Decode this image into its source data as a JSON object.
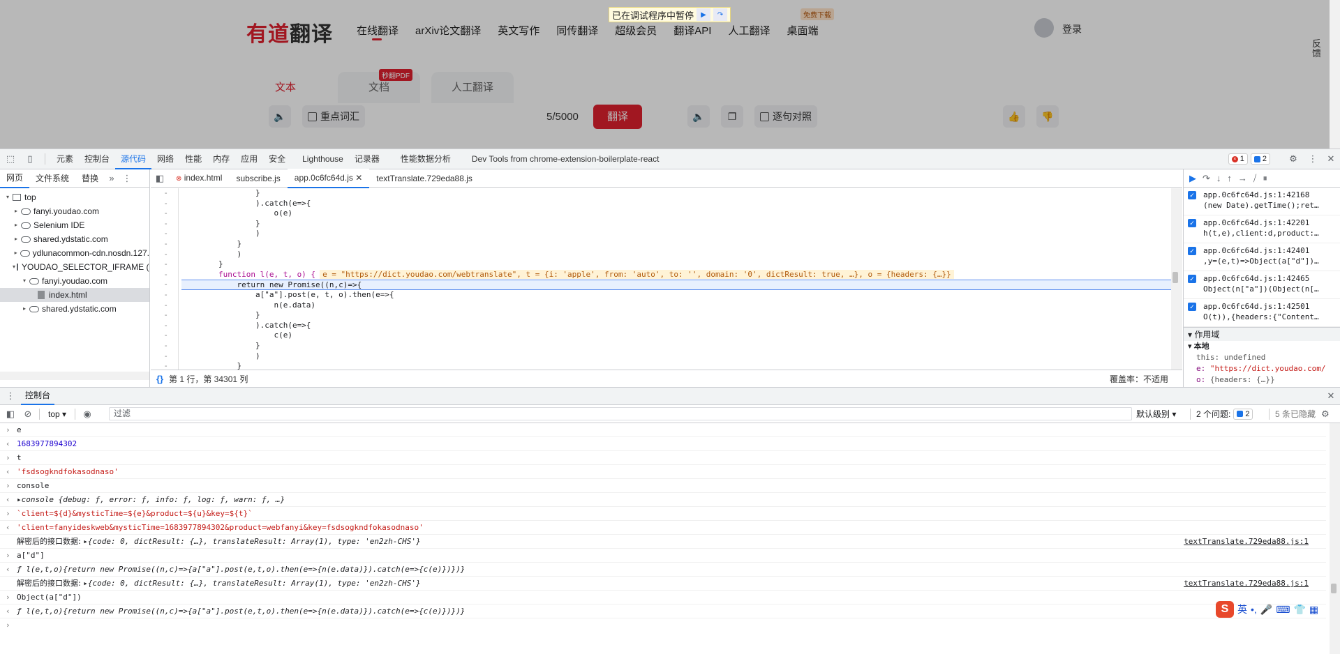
{
  "webpage": {
    "logo_red": "有道",
    "logo_dark": "翻译",
    "nav": [
      "在线翻译",
      "arXiv论文翻译",
      "英文写作",
      "同传翻译",
      "超级会员",
      "翻译API",
      "人工翻译",
      "桌面端"
    ],
    "download_badge": "免费下载",
    "paused_text": "已在调试程序中暂停",
    "login": "登录",
    "feedback": "反馈",
    "tabs": [
      "文本",
      "文档",
      "人工翻译"
    ],
    "pdf_badge": "秒翻PDF",
    "key_vocab": "重点词汇",
    "char_count": "5/5000",
    "translate_button": "翻译",
    "sentence_compare": "逐句对照"
  },
  "devtools": {
    "main_tabs": [
      "元素",
      "控制台",
      "源代码",
      "网络",
      "性能",
      "内存",
      "应用",
      "安全",
      "Lighthouse",
      "记录器",
      "性能数据分析",
      "Dev Tools from chrome-extension-boilerplate-react"
    ],
    "active_main_tab": "源代码",
    "error_count": "1",
    "message_count": "2",
    "navigator_tabs": [
      "网页",
      "文件系统",
      "替换"
    ],
    "tree": [
      {
        "label": "top",
        "depth": 0,
        "icon": "frame",
        "open": true
      },
      {
        "label": "fanyi.youdao.com",
        "depth": 1,
        "icon": "cloud"
      },
      {
        "label": "Selenium IDE",
        "depth": 1,
        "icon": "cloud"
      },
      {
        "label": "shared.ydstatic.com",
        "depth": 1,
        "icon": "cloud"
      },
      {
        "label": "ydlunacommon-cdn.nosdn.127.",
        "depth": 1,
        "icon": "cloud"
      },
      {
        "label": "YOUDAO_SELECTOR_IFRAME (in",
        "depth": 1,
        "icon": "frame",
        "open": true
      },
      {
        "label": "fanyi.youdao.com",
        "depth": 2,
        "icon": "cloud",
        "open": true
      },
      {
        "label": "index.html",
        "depth": 3,
        "icon": "file",
        "selected": true
      },
      {
        "label": "shared.ydstatic.com",
        "depth": 2,
        "icon": "cloud"
      }
    ],
    "editor_tabs": [
      "index.html",
      "subscribe.js",
      "app.0c6fc64d.js",
      "textTranslate.729eda88.js"
    ],
    "active_editor_tab": "app.0c6fc64d.js",
    "code_lines": [
      "                }",
      "                ).catch(e=>{",
      "                    o(e)",
      "                }",
      "                )",
      "            }",
      "            )",
      "        }",
      "        function l(e, t, o) {",
      "            return new Promise((n,c)=>{",
      "                a[\"a\"].post(e, t, o).then(e=>{",
      "                    n(e.data)",
      "                }",
      "                ).catch(e=>{",
      "                    c(e)",
      "                }",
      "                )",
      "            }",
      "            )"
    ],
    "inline_values": "e = \"https://dict.youdao.com/webtranslate\", t = {i: 'apple', from: 'auto', to: '', domain: '0', dictResult: true, …}, o = {headers: {…}}",
    "cursor_position": "第 1 行，第 34301 列",
    "coverage": "覆盖率：不适用",
    "breakpoints": [
      {
        "loc": "app.0c6fc64d.js:1:42168",
        "src": "(new Date).getTime();ret…"
      },
      {
        "loc": "app.0c6fc64d.js:1:42201",
        "src": "h(t,e),client:d,product:…"
      },
      {
        "loc": "app.0c6fc64d.js:1:42401",
        "src": ",y=(e,t)=>Object(a[\"d\"])…"
      },
      {
        "loc": "app.0c6fc64d.js:1:42465",
        "src": "Object(n[\"a\"])(Object(n[…"
      },
      {
        "loc": "app.0c6fc64d.js:1:42501",
        "src": "O(t)),{headers:{\"Content…"
      }
    ],
    "scope_header": "作用域",
    "scope_local": "本地",
    "scope_rows": [
      {
        "k": "this:",
        "v": "undefined"
      },
      {
        "k": "e:",
        "v": "\"https://dict.youdao.com/"
      },
      {
        "k": "o:",
        "v": "{headers: {…}}"
      }
    ],
    "drawer_tab": "控制台",
    "console_context": "top",
    "filter_placeholder": "过滤",
    "log_level": "默认级别",
    "issues_label": "2 个问题:",
    "issues_count": "2",
    "hidden_count": "5 条已隐藏",
    "console_lines": [
      {
        "kind": "in",
        "text": "e"
      },
      {
        "kind": "out",
        "cls": "c-num",
        "text": "1683977894302"
      },
      {
        "kind": "in",
        "text": "t"
      },
      {
        "kind": "out",
        "cls": "c-str",
        "text": "'fsdsogkndfokasodnaso'"
      },
      {
        "kind": "in",
        "text": "console"
      },
      {
        "kind": "out",
        "cls": "c-obj",
        "text": "▸console {debug: ƒ, error: ƒ, info: ƒ, log: ƒ, warn: ƒ, …}"
      },
      {
        "kind": "in",
        "cls": "c-str",
        "text": "`client=${d}&mysticTime=${e}&product=${u}&key=${t}`"
      },
      {
        "kind": "out",
        "cls": "c-str",
        "text": "'client=fanyideskweb&mysticTime=1683977894302&product=webfanyi&key=fsdsogkndfokasodnaso'"
      },
      {
        "kind": "log",
        "label": "解密后的接口数据:",
        "text": "▸{code: 0, dictResult: {…}, translateResult: Array(1), type: 'en2zh-CHS'}",
        "link": "textTranslate.729eda88.js:1"
      },
      {
        "kind": "in",
        "text": "a[\"d\"]"
      },
      {
        "kind": "out",
        "cls": "c-it",
        "text": "ƒ l(e,t,o){return new Promise((n,c)=>{a[\"a\"].post(e,t,o).then(e=>{n(e.data)}).catch(e=>{c(e)})})}"
      },
      {
        "kind": "log",
        "label": "解密后的接口数据:",
        "text": "▸{code: 0, dictResult: {…}, translateResult: Array(1), type: 'en2zh-CHS'}",
        "link": "textTranslate.729eda88.js:1"
      },
      {
        "kind": "in",
        "text": "Object(a[\"d\"])"
      },
      {
        "kind": "out",
        "cls": "c-it",
        "text": "ƒ l(e,t,o){return new Promise((n,c)=>{a[\"a\"].post(e,t,o).then(e=>{n(e.data)}).catch(e=>{c(e)})})}"
      },
      {
        "kind": "prompt",
        "text": ""
      }
    ]
  },
  "ime": {
    "logo": "S",
    "lang": "英"
  }
}
